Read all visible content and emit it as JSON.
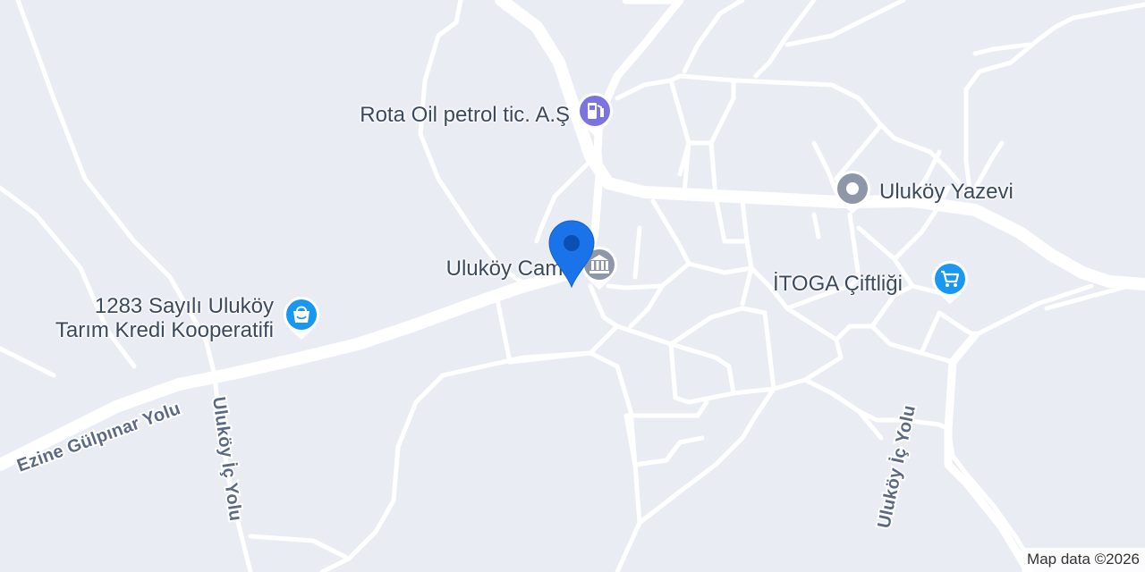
{
  "map": {
    "roads": {
      "ezine_gulpinar": "Ezine Gülpınar Yolu",
      "ic_yolu_left": "Uluköy İç Yolu",
      "ic_yolu_right": "Uluköy İç Yolu"
    },
    "pois": {
      "gas_station": {
        "label": "Rota Oil petrol tic. A.Ş",
        "icon": "gas-station-icon",
        "color": "#7b74e0"
      },
      "yazevi": {
        "label": "Uluköy Yazevi",
        "icon": "place-icon",
        "color": "#8d97a8"
      },
      "mosque": {
        "label": "Uluköy Camii",
        "icon": "museum-icon",
        "color": "#8d97a8"
      },
      "farm": {
        "label": "İTOGA Çiftliği",
        "icon": "shopping-cart-icon",
        "color": "#1a97f0"
      },
      "cooperative": {
        "line1": "1283 Sayılı Uluköy",
        "line2": "Tarım Kredi Kooperatifi",
        "icon": "shopping-bag-icon",
        "color": "#1a97f0"
      }
    },
    "marker": {
      "icon": "location-marker-icon",
      "color": "#1a73e8"
    },
    "attribution": "Map data ©2026"
  }
}
